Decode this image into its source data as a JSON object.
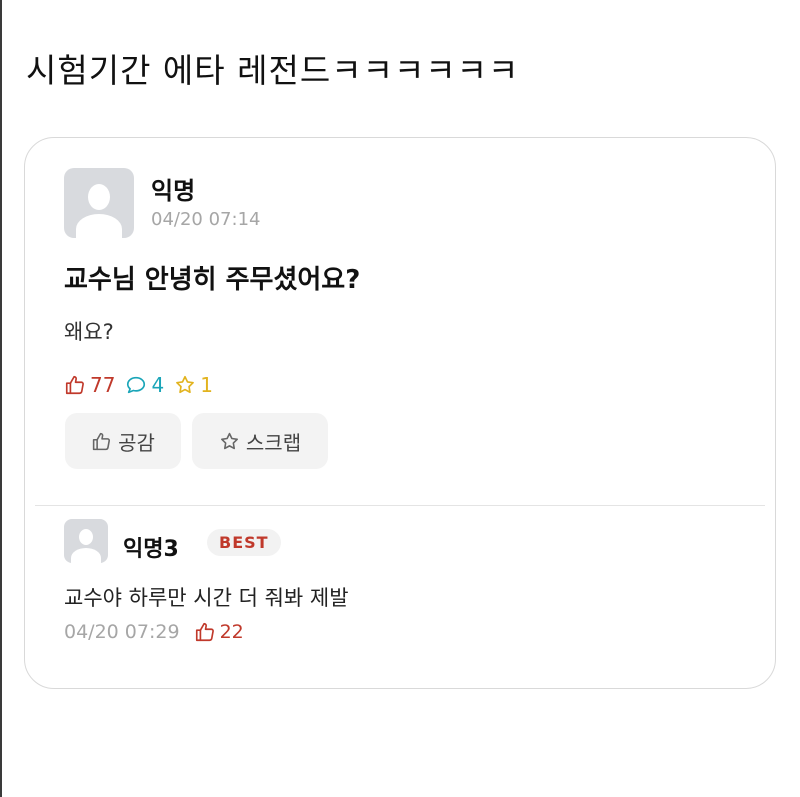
{
  "headline": "시험기간 에타 레전드ㅋㅋㅋㅋㅋㅋ",
  "post": {
    "author": "익명",
    "time": "04/20 07:14",
    "title": "교수님 안녕히 주무셨어요?",
    "body": "왜요?",
    "likes": "77",
    "comments": "4",
    "scraps": "1",
    "like_button": "공감",
    "scrap_button": "스크랩"
  },
  "comment": {
    "author": "익명3",
    "badge": "BEST",
    "text": "교수야 하루만 시간 더 줘봐 제발",
    "time": "04/20 07:29",
    "likes": "22"
  },
  "colors": {
    "like": "#c0392b",
    "comment": "#1aa5b8",
    "scrap": "#e2b31e",
    "meta_gray": "#a6a6a6"
  },
  "icons": [
    "thumbs-up-icon",
    "comment-bubble-icon",
    "star-icon",
    "default-avatar-icon"
  ]
}
